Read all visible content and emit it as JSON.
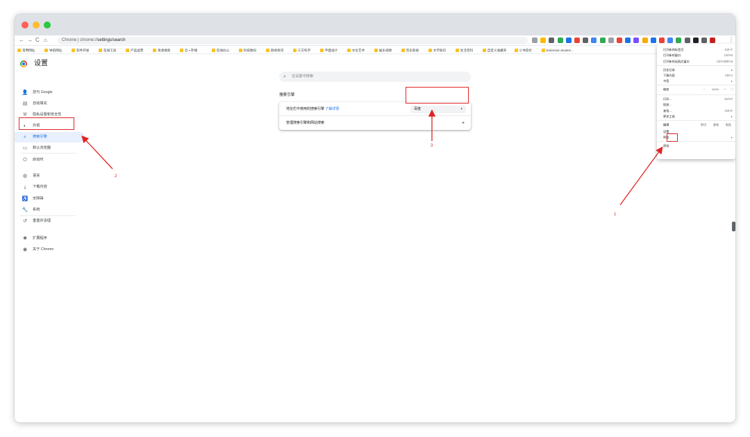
{
  "window": {
    "traffic_lights": {
      "close": "#ff5f57",
      "minimize": "#febc2e",
      "zoom": "#28c840"
    }
  },
  "toolbar": {
    "back": "←",
    "forward": "→",
    "reload": "C",
    "home": "⌂",
    "url_prefix": "Chrome | chrome://",
    "url_main": "settings/search",
    "site_info_icon": "chrome-icon"
  },
  "bookmarks": [
    "常用网址",
    "导航网址",
    "软件开发",
    "在线工具",
    "产品运营",
    "资源搜索",
    "云 ▪ 存储",
    "在线办公",
    "科技数码",
    "新闻资讯",
    "三方科学",
    "平面设计",
    "文化艺术",
    "娱乐视频",
    "音乐影视",
    "文学知识",
    "生活百科",
    "自定义收藏夹",
    "小书签栏",
    "Extension Bookm..."
  ],
  "settings": {
    "title": "设置",
    "search_placeholder": "在设置中搜索",
    "nav": [
      {
        "icon": "person-icon",
        "glyph": "👤",
        "label": "您与 Google"
      },
      {
        "icon": "autofill-icon",
        "glyph": "▤",
        "label": "自动填充"
      },
      {
        "icon": "shield-icon",
        "glyph": "⛨",
        "label": "隐私设置和安全性"
      },
      {
        "icon": "palette-icon",
        "glyph": "◐",
        "label": "外观"
      },
      {
        "icon": "search-icon",
        "glyph": "⌕",
        "label": "搜索引擎"
      },
      {
        "icon": "browser-icon",
        "glyph": "▭",
        "label": "默认浏览器"
      },
      {
        "icon": "power-icon",
        "glyph": "⏻",
        "label": "启动时"
      },
      {
        "icon": "globe-icon",
        "glyph": "◍",
        "label": "语言"
      },
      {
        "icon": "download-icon",
        "glyph": "⤓",
        "label": "下载内容"
      },
      {
        "icon": "accessibility-icon",
        "glyph": "♿",
        "label": "无障碍"
      },
      {
        "icon": "wrench-icon",
        "glyph": "🔧",
        "label": "系统"
      },
      {
        "icon": "reset-icon",
        "glyph": "↺",
        "label": "重置并清理"
      },
      {
        "icon": "puzzle-icon",
        "glyph": "✱",
        "label": "扩展程序"
      },
      {
        "icon": "chrome-logo-icon",
        "glyph": "◉",
        "label": "关于 Chrome"
      }
    ],
    "section_title": "搜索引擎",
    "row1_label": "地址栏中使用的搜索引擎",
    "row1_link": "了解详情",
    "selected_engine": "百度",
    "row2_label": "管理搜索引擎和网站搜索"
  },
  "menu": {
    "items": [
      {
        "label": "打开新的标签页",
        "shortcut": "Ctrl+T"
      },
      {
        "label": "打开新的窗口",
        "shortcut": "Ctrl+N"
      },
      {
        "label": "打开新的无痕式窗口",
        "shortcut": "Ctrl+Shift+N"
      },
      {
        "label": "历史记录",
        "shortcut": "▸"
      },
      {
        "label": "下载内容",
        "shortcut": "Ctrl+J"
      },
      {
        "label": "书签",
        "shortcut": "▸"
      },
      {
        "label": "缩放",
        "shortcut": ""
      },
      {
        "label": "打印...",
        "shortcut": "Ctrl+P"
      },
      {
        "label": "投放...",
        "shortcut": ""
      },
      {
        "label": "查找...",
        "shortcut": "Ctrl+F"
      },
      {
        "label": "更多工具",
        "shortcut": "▸"
      },
      {
        "label": "编辑",
        "shortcut": ""
      },
      {
        "label": "设置",
        "shortcut": ""
      },
      {
        "label": "帮助",
        "shortcut": "▸"
      },
      {
        "label": "退出",
        "shortcut": ""
      }
    ],
    "zoom_minus": "−",
    "zoom_value": "100%",
    "zoom_plus": "+",
    "edit_cut": "剪切",
    "edit_copy": "复制",
    "edit_paste": "粘贴"
  },
  "annotations": {
    "label1": "1",
    "label2": "2",
    "label3": "3",
    "color": "#e02424"
  }
}
